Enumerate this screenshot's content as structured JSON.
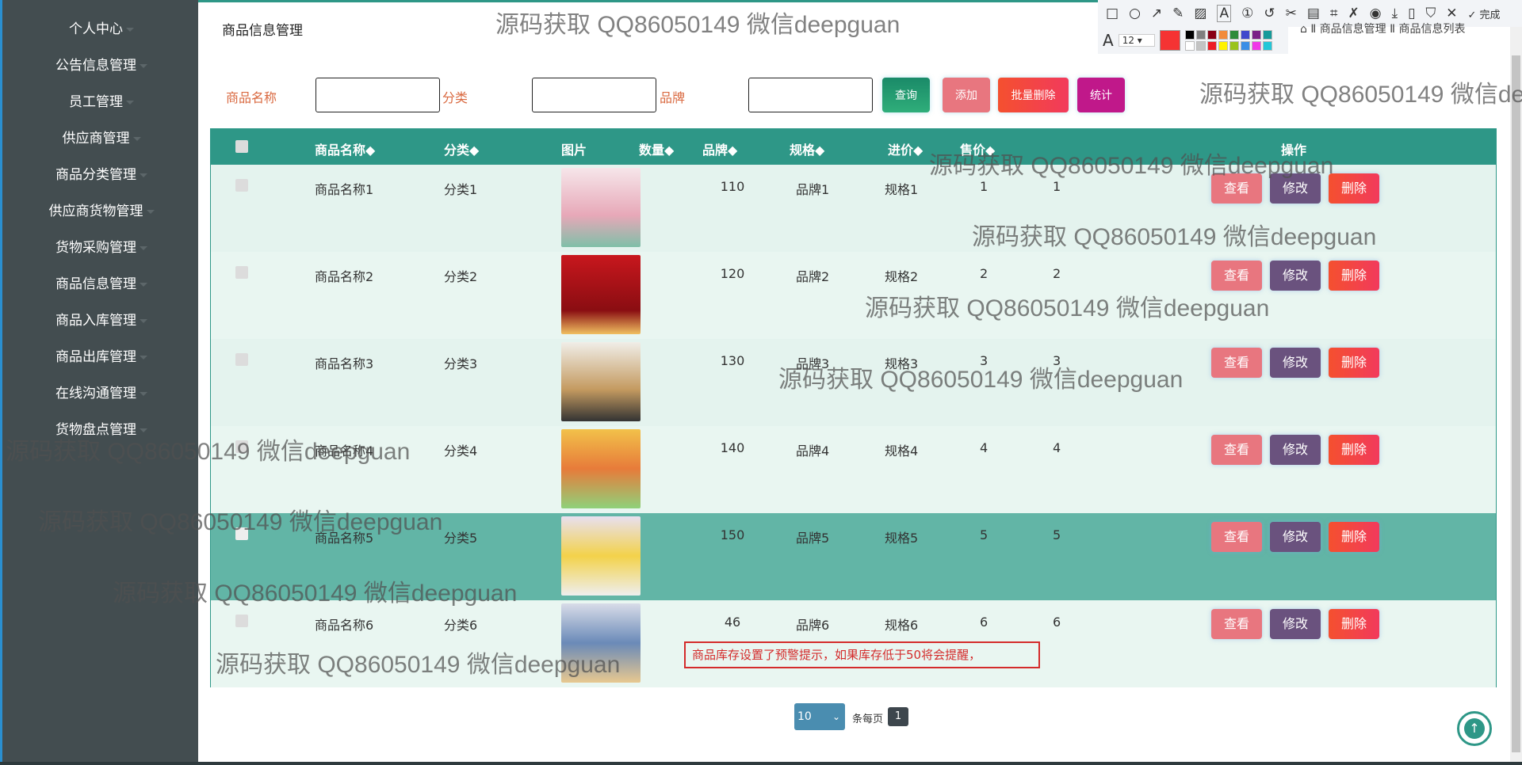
{
  "sidebar": {
    "items": [
      "个人中心",
      "公告信息管理",
      "员工管理",
      "供应商管理",
      "商品分类管理",
      "供应商货物管理",
      "货物采购管理",
      "商品信息管理",
      "商品入库管理",
      "商品出库管理",
      "在线沟通管理",
      "货物盘点管理"
    ]
  },
  "page_title": "商品信息管理",
  "breadcrumb": "商品信息管理 Ⅱ 商品信息列表",
  "search": {
    "name_label": "商品名称",
    "category_label": "分类",
    "brand_label": "品牌",
    "name_value": "",
    "category_value": "",
    "brand_value": "",
    "query": "查询",
    "add": "添加",
    "batch_delete": "批量删除",
    "stats": "统计"
  },
  "colors": {
    "header": "#2e9787",
    "query": "#1f9a6c",
    "add": "#e8767f",
    "batch_delete": "#f44c3c",
    "stats": "#c0188a",
    "view": "#e8767f",
    "edit": "#6a527e",
    "delete": "#f44540"
  },
  "table": {
    "headers": [
      "商品名称◆",
      "分类◆",
      "图片",
      "数量◆",
      "品牌◆",
      "规格◆",
      "进价◆",
      "售价◆",
      "操作"
    ],
    "actions": {
      "view": "查看",
      "edit": "修改",
      "delete": "删除"
    },
    "rows": [
      {
        "name": "商品名称1",
        "category": "分类1",
        "qty": "110",
        "brand": "品牌1",
        "spec": "规格1",
        "buy": "1",
        "sell": "1"
      },
      {
        "name": "商品名称2",
        "category": "分类2",
        "qty": "120",
        "brand": "品牌2",
        "spec": "规格2",
        "buy": "2",
        "sell": "2"
      },
      {
        "name": "商品名称3",
        "category": "分类3",
        "qty": "130",
        "brand": "品牌3",
        "spec": "规格3",
        "buy": "3",
        "sell": "3"
      },
      {
        "name": "商品名称4",
        "category": "分类4",
        "qty": "140",
        "brand": "品牌4",
        "spec": "规格4",
        "buy": "4",
        "sell": "4"
      },
      {
        "name": "商品名称5",
        "category": "分类5",
        "qty": "150",
        "brand": "品牌5",
        "spec": "规格5",
        "buy": "5",
        "sell": "5"
      },
      {
        "name": "商品名称6",
        "category": "分类6",
        "qty": "46",
        "brand": "品牌6",
        "spec": "规格6",
        "buy": "6",
        "sell": "6"
      }
    ]
  },
  "annotation_note": "商品库存设置了预警提示，如果库存低于50将会提醒，",
  "pagination": {
    "page_size": "10",
    "per_page_label": "条每页",
    "current_page": "1"
  },
  "screenshot_toolbar": {
    "done": "完成",
    "font_size": "12",
    "font_icon": "A"
  },
  "watermark": "源码获取 QQ86050149 微信deepguan"
}
